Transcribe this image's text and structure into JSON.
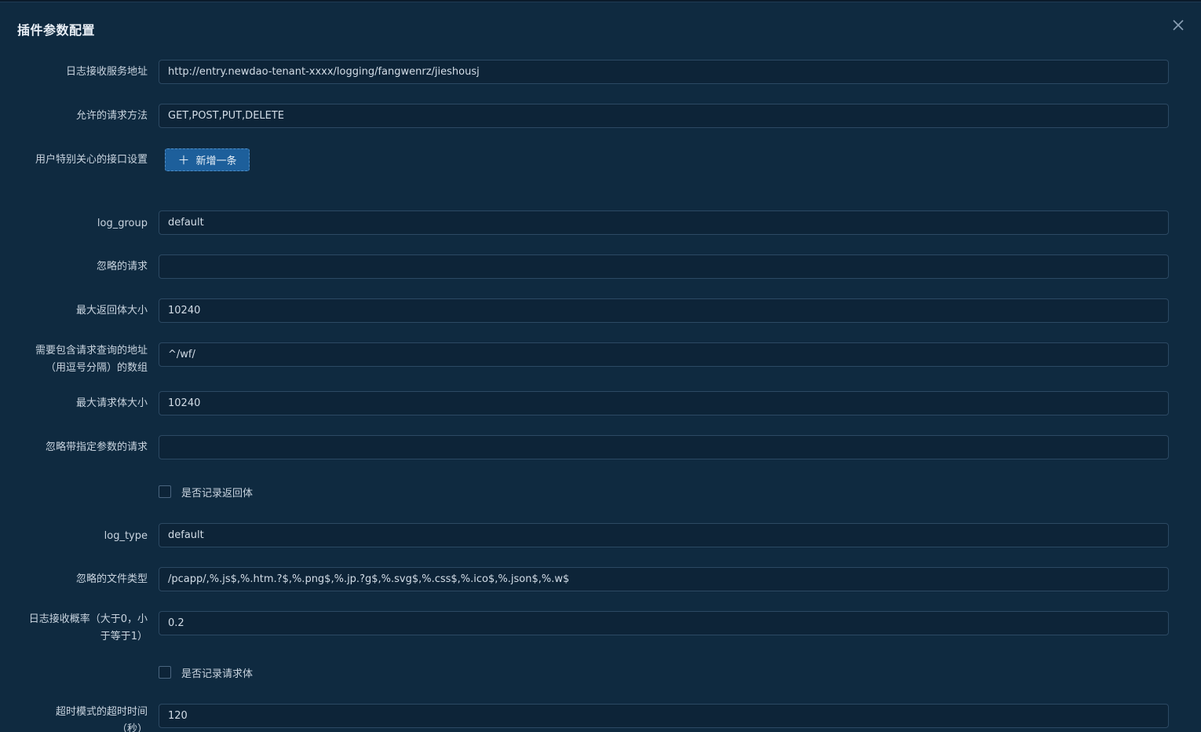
{
  "dialog": {
    "title": "插件参数配置",
    "close_icon": "close-icon"
  },
  "fields": {
    "log_url": {
      "label": "日志接收服务地址",
      "value": "http://entry.newdao-tenant-xxxx/logging/fangwenrz/jieshousj"
    },
    "allowed_methods": {
      "label": "允许的请求方法",
      "value": "GET,POST,PUT,DELETE"
    },
    "special_api": {
      "label": "用户特别关心的接口设置",
      "button_label": "新增一条",
      "button_icon": "plus-icon"
    },
    "log_group": {
      "label": "log_group",
      "value": "default"
    },
    "ignored_requests": {
      "label": "忽略的请求",
      "value": ""
    },
    "max_response_size": {
      "label": "最大返回体大小",
      "value": "10240"
    },
    "include_query_urls": {
      "label_line1": "需要包含请求查询的地址",
      "label_line2": "（用逗号分隔）的数组",
      "value": "^/wf/"
    },
    "max_request_size": {
      "label": "最大请求体大小",
      "value": "10240"
    },
    "ignore_with_params": {
      "label": "忽略带指定参数的请求",
      "value": ""
    },
    "record_response_body": {
      "label": "是否记录返回体",
      "checked": false
    },
    "log_type": {
      "label": "log_type",
      "value": "default"
    },
    "ignored_file_types": {
      "label": "忽略的文件类型",
      "value": "/pcapp/,%.js$,%.htm.?$,%.png$,%.jp.?g$,%.svg$,%.css$,%.ico$,%.json$,%.w$"
    },
    "sample_rate": {
      "label_line1": "日志接收概率（大于0，小",
      "label_line2": "于等于1）",
      "value": "0.2"
    },
    "record_request_body": {
      "label": "是否记录请求体",
      "checked": false
    },
    "timeout": {
      "label_line1": "超时模式的超时时间",
      "label_line2": "（秒）",
      "value": "120"
    }
  },
  "colors": {
    "background": "#0f2a40",
    "input_border": "#2c4963",
    "button_bg": "#1d5f9b",
    "text": "#c9d4df"
  }
}
